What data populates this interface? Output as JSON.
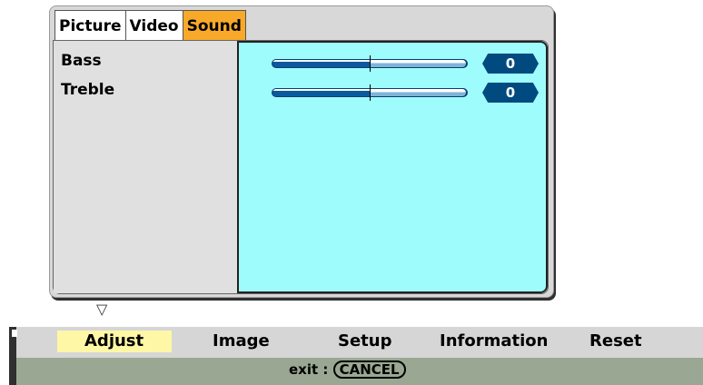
{
  "tabs": [
    {
      "label": "Picture",
      "active": false
    },
    {
      "label": "Video",
      "active": false
    },
    {
      "label": "Sound",
      "active": true
    }
  ],
  "settings": [
    {
      "label": "Bass",
      "value": "0",
      "slider_fraction": 0.5
    },
    {
      "label": "Treble",
      "value": "0",
      "slider_fraction": 0.5
    }
  ],
  "menu": {
    "items": [
      {
        "label": "Adjust",
        "active": true
      },
      {
        "label": "Image",
        "active": false
      },
      {
        "label": "Setup",
        "active": false
      },
      {
        "label": "Information",
        "active": false
      },
      {
        "label": "Reset",
        "active": false
      }
    ],
    "exit_label": "exit :",
    "cancel_key": "CANCEL"
  },
  "icons": {
    "down_arrow": "triangle-down-outline-icon"
  },
  "colors": {
    "active_tab": "#f8a92a",
    "value_area": "#9ffcfd",
    "active_menu": "#fdf7a6",
    "slider_dark": "#0a5aa0",
    "badge": "#004a80"
  }
}
